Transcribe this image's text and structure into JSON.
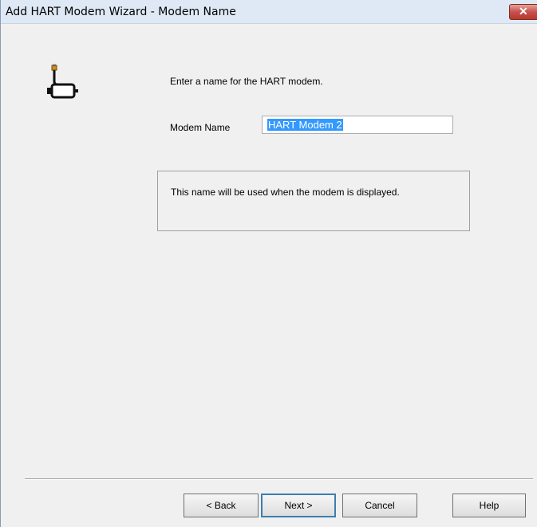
{
  "window": {
    "title": "Add HART Modem Wizard - Modem Name",
    "close_glyph": "✕"
  },
  "icon": {
    "name": "modem-icon"
  },
  "content": {
    "prompt": "Enter a name for the HART modem.",
    "modem_name_label": "Modem Name",
    "modem_name_value": "HART Modem 2",
    "info_text": "This name will be used when the modem is displayed."
  },
  "buttons": {
    "back": "< Back",
    "next": "Next >",
    "cancel": "Cancel",
    "help": "Help"
  },
  "colors": {
    "selection": "#3399ff",
    "close_button": "#c75050",
    "window_bg": "#f0f0f0"
  }
}
